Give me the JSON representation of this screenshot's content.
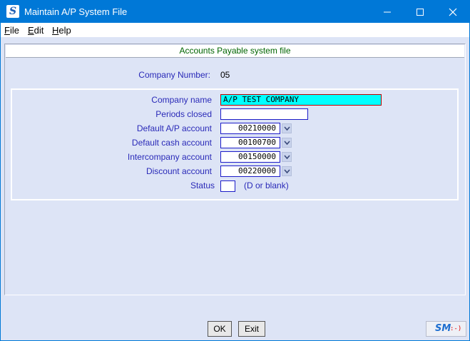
{
  "window": {
    "title": "Maintain A/P System File",
    "app_icon_letter": "S",
    "minimize_glyph": "─",
    "maximize_glyph": "☐",
    "close_glyph": "✕"
  },
  "menu": {
    "items": [
      {
        "first": "F",
        "rest": "ile"
      },
      {
        "first": "E",
        "rest": "dit"
      },
      {
        "first": "H",
        "rest": "elp"
      }
    ]
  },
  "panel": {
    "header": "Accounts Payable system file",
    "company_number_label": "Company Number:",
    "company_number": "05"
  },
  "form": {
    "company_name_label": "Company name",
    "company_name": "A/P TEST COMPANY",
    "periods_closed_label": "Periods closed",
    "periods_closed": "",
    "default_ap_label": "Default A/P account",
    "default_ap": "00210000",
    "default_cash_label": "Default cash account",
    "default_cash": "00100700",
    "intercompany_label": "Intercompany account",
    "intercompany": "00150000",
    "discount_label": "Discount account",
    "discount": "00220000",
    "status_label": "Status",
    "status": "",
    "status_hint": "(D or blank)"
  },
  "buttons": {
    "ok": "OK",
    "exit": "Exit"
  },
  "logo": {
    "sm": "SM",
    "smile": ":-)"
  },
  "colors": {
    "titlebar": "#0078d7",
    "background": "#dde4f6",
    "label": "#2a2ab8",
    "highlight_field": "#00ffff",
    "header_text": "#006400"
  }
}
